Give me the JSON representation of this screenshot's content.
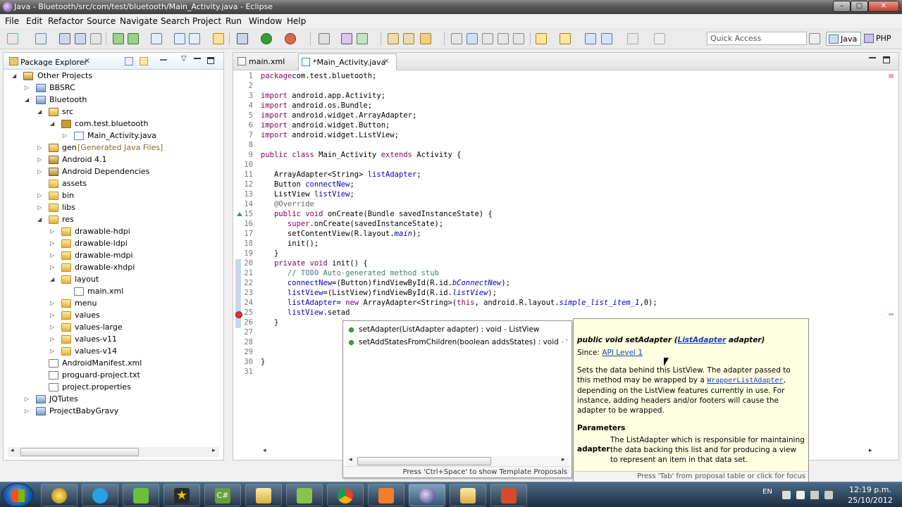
{
  "window": {
    "title": "Java - Bluetooth/src/com/test/bluetooth/Main_Activity.java - Eclipse",
    "min": "–",
    "max": "□",
    "close": "✕"
  },
  "menu": [
    "File",
    "Edit",
    "Refactor",
    "Source",
    "Navigate",
    "Search",
    "Project",
    "Run",
    "Window",
    "Help"
  ],
  "toolbar": {
    "quick_access_placeholder": "Quick Access",
    "perspectives": [
      "Java",
      "PHP"
    ]
  },
  "package_explorer": {
    "title": "Package Explorer",
    "tree": [
      {
        "label": "Other Projects",
        "icon": "working-set-icon"
      },
      {
        "label": "BBSRC",
        "icon": "project-icon"
      },
      {
        "label": "Bluetooth",
        "icon": "project-icon"
      },
      {
        "label": "src",
        "icon": "source-folder-icon"
      },
      {
        "label": "com.test.bluetooth",
        "icon": "package-icon"
      },
      {
        "label": "Main_Activity.java",
        "icon": "java-file-icon"
      },
      {
        "label": "gen",
        "decoration": "[Generated Java Files]",
        "icon": "source-folder-icon"
      },
      {
        "label": "Android 4.1",
        "icon": "library-icon"
      },
      {
        "label": "Android Dependencies",
        "icon": "library-icon"
      },
      {
        "label": "assets",
        "icon": "folder-icon"
      },
      {
        "label": "bin",
        "icon": "folder-icon"
      },
      {
        "label": "libs",
        "icon": "folder-icon"
      },
      {
        "label": "res",
        "icon": "folder-icon"
      },
      {
        "label": "drawable-hdpi",
        "icon": "folder-icon"
      },
      {
        "label": "drawable-ldpi",
        "icon": "folder-icon"
      },
      {
        "label": "drawable-mdpi",
        "icon": "folder-icon"
      },
      {
        "label": "drawable-xhdpi",
        "icon": "folder-icon"
      },
      {
        "label": "layout",
        "icon": "folder-icon"
      },
      {
        "label": "main.xml",
        "icon": "xml-file-icon"
      },
      {
        "label": "menu",
        "icon": "folder-icon"
      },
      {
        "label": "values",
        "icon": "folder-icon"
      },
      {
        "label": "values-large",
        "icon": "folder-icon"
      },
      {
        "label": "values-v11",
        "icon": "folder-icon"
      },
      {
        "label": "values-v14",
        "icon": "folder-icon"
      },
      {
        "label": "AndroidManifest.xml",
        "icon": "xml-file-icon"
      },
      {
        "label": "proguard-project.txt",
        "icon": "text-file-icon"
      },
      {
        "label": "project.properties",
        "icon": "text-file-icon"
      },
      {
        "label": "JQTutes",
        "icon": "project-icon"
      },
      {
        "label": "ProjectBabyGravy",
        "icon": "project-icon"
      }
    ]
  },
  "editor": {
    "tabs": [
      {
        "label": "main.xml"
      },
      {
        "label": "*Main_Activity.java"
      }
    ],
    "lines": [
      {
        "n": "1",
        "parts": [
          [
            "kw",
            "package"
          ],
          [
            "",
            "com.test.bluetooth;"
          ]
        ]
      },
      {
        "n": "2",
        "parts": []
      },
      {
        "n": "3",
        "parts": [
          [
            "kw",
            "import"
          ],
          [
            "",
            " android.app.Activity;"
          ]
        ]
      },
      {
        "n": "4",
        "parts": [
          [
            "kw",
            "import"
          ],
          [
            "",
            " android.os.Bundle;"
          ]
        ]
      },
      {
        "n": "5",
        "parts": [
          [
            "kw",
            "import"
          ],
          [
            "",
            " android.widget.ArrayAdapter;"
          ]
        ]
      },
      {
        "n": "6",
        "parts": [
          [
            "kw",
            "import"
          ],
          [
            "",
            " android.widget.Button;"
          ]
        ]
      },
      {
        "n": "7",
        "parts": [
          [
            "kw",
            "import"
          ],
          [
            "",
            " android.widget.ListView;"
          ]
        ]
      },
      {
        "n": "8",
        "parts": []
      },
      {
        "n": "9",
        "parts": [
          [
            "kw",
            "public class"
          ],
          [
            "",
            " Main_Activity "
          ],
          [
            "kw",
            "extends"
          ],
          [
            "",
            " Activity {"
          ]
        ]
      },
      {
        "n": "10",
        "parts": []
      },
      {
        "n": "11",
        "parts": [
          [
            "",
            "   ArrayAdapter<String> "
          ],
          [
            "fld",
            "listAdapter"
          ],
          [
            "",
            ";"
          ]
        ]
      },
      {
        "n": "12",
        "parts": [
          [
            "",
            "   Button "
          ],
          [
            "fld",
            "connectNew"
          ],
          [
            "",
            ";"
          ]
        ]
      },
      {
        "n": "13",
        "parts": [
          [
            "",
            "   ListView "
          ],
          [
            "fld",
            "listView"
          ],
          [
            "",
            ";"
          ]
        ]
      },
      {
        "n": "14",
        "parts": [
          [
            "ann",
            "   @Override"
          ]
        ]
      },
      {
        "n": "15",
        "parts": [
          [
            "kw",
            "   public void"
          ],
          [
            "",
            " onCreate(Bundle savedInstanceState) {"
          ]
        ]
      },
      {
        "n": "16",
        "parts": [
          [
            "kw",
            "      super"
          ],
          [
            "",
            ".onCreate(savedInstanceState);"
          ]
        ]
      },
      {
        "n": "17",
        "parts": [
          [
            "",
            "      setContentView(R.layout."
          ],
          [
            "ital",
            "main"
          ],
          [
            "",
            ");"
          ]
        ]
      },
      {
        "n": "18",
        "parts": [
          [
            "",
            "      init();"
          ]
        ]
      },
      {
        "n": "19",
        "parts": [
          [
            "",
            "   }"
          ]
        ]
      },
      {
        "n": "20",
        "parts": [
          [
            "kw",
            "   private void"
          ],
          [
            "",
            " init() {"
          ]
        ]
      },
      {
        "n": "21",
        "parts": [
          [
            "cmt",
            "      // "
          ],
          [
            "todo",
            "TODO"
          ],
          [
            "cmt",
            " Auto-generated method stub"
          ]
        ]
      },
      {
        "n": "22",
        "parts": [
          [
            "fld",
            "      connectNew"
          ],
          [
            "",
            "=(Button)findViewById(R.id."
          ],
          [
            "ital",
            "bConnectNew"
          ],
          [
            "",
            ");"
          ]
        ]
      },
      {
        "n": "23",
        "parts": [
          [
            "fld",
            "      listView"
          ],
          [
            "",
            "=(ListView)findViewById(R.id."
          ],
          [
            "ital",
            "listView"
          ],
          [
            "",
            ");"
          ]
        ]
      },
      {
        "n": "24",
        "parts": [
          [
            "fld",
            "      listAdapter"
          ],
          [
            "",
            "= "
          ],
          [
            "kw",
            "new"
          ],
          [
            "",
            " ArrayAdapter<String>("
          ],
          [
            "kw",
            "this"
          ],
          [
            "",
            ", android.R.layout."
          ],
          [
            "ital",
            "simple_list_item_1"
          ],
          [
            "",
            ",0);"
          ]
        ]
      },
      {
        "n": "25",
        "parts": [
          [
            "fld",
            "      listView"
          ],
          [
            "",
            ".setad"
          ]
        ]
      },
      {
        "n": "26",
        "parts": [
          [
            "",
            "   }"
          ]
        ]
      },
      {
        "n": "27",
        "parts": []
      },
      {
        "n": "28",
        "parts": []
      },
      {
        "n": "29",
        "parts": []
      },
      {
        "n": "30",
        "parts": [
          [
            "",
            "}"
          ]
        ]
      },
      {
        "n": "31",
        "parts": []
      }
    ]
  },
  "content_assist": {
    "items": [
      {
        "label": "setAdapter(ListAdapter adapter) : void - ListView",
        "qualifier": ""
      },
      {
        "label": "setAddStatesFromChildren(boolean addsStates) : void",
        "qualifier": " - View"
      }
    ],
    "footer": "Press 'Ctrl+Space' to show Template Proposals"
  },
  "javadoc": {
    "signature_prefix": "public void setAdapter (",
    "signature_type": "ListAdapter",
    "signature_suffix": " adapter)",
    "since_label": "Since:",
    "since_value": "API Level 1",
    "desc_1": "Sets the data behind this ListView. The adapter passed to this method may be wrapped by a",
    "desc_link": "WrapperListAdapter",
    "desc_2": ", depending on the ListView features currently in use. For instance, adding headers and/or footers will cause the adapter to be wrapped.",
    "params_heading": "Parameters",
    "param_name": "adapter",
    "param_desc": "The ListAdapter which is responsible for maintaining the data backing this list and for producing a view to represent an item in that data set.",
    "footer": "Press 'Tab' from proposal table or click for focus"
  },
  "taskbar": {
    "language": "EN",
    "time": "12:19 p.m.",
    "date": "25/10/2012"
  },
  "colors": {
    "keyword": "#7f0055",
    "field": "#0000c0",
    "comment": "#3f7f5f",
    "doc_bg": "#ffffe1"
  }
}
